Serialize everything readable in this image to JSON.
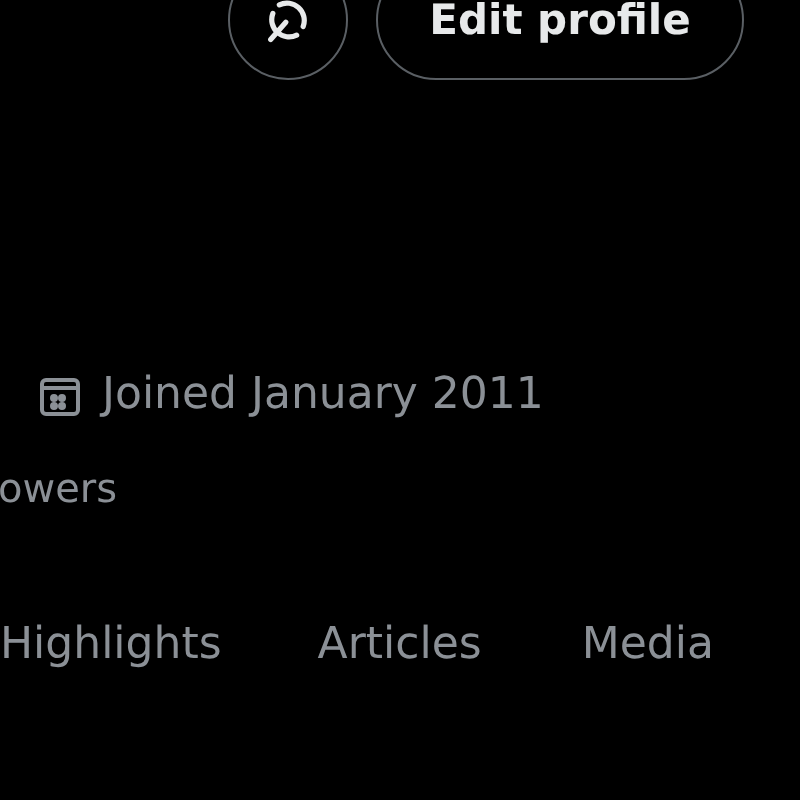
{
  "actions": {
    "edit_button": "Edit profile"
  },
  "profile": {
    "joined": "Joined January 2011",
    "followers_fragment": "owers"
  },
  "tabs": [
    {
      "label": "Highlights",
      "selected": false
    },
    {
      "label": "Articles",
      "selected": false
    },
    {
      "label": "Media",
      "selected": false
    }
  ]
}
